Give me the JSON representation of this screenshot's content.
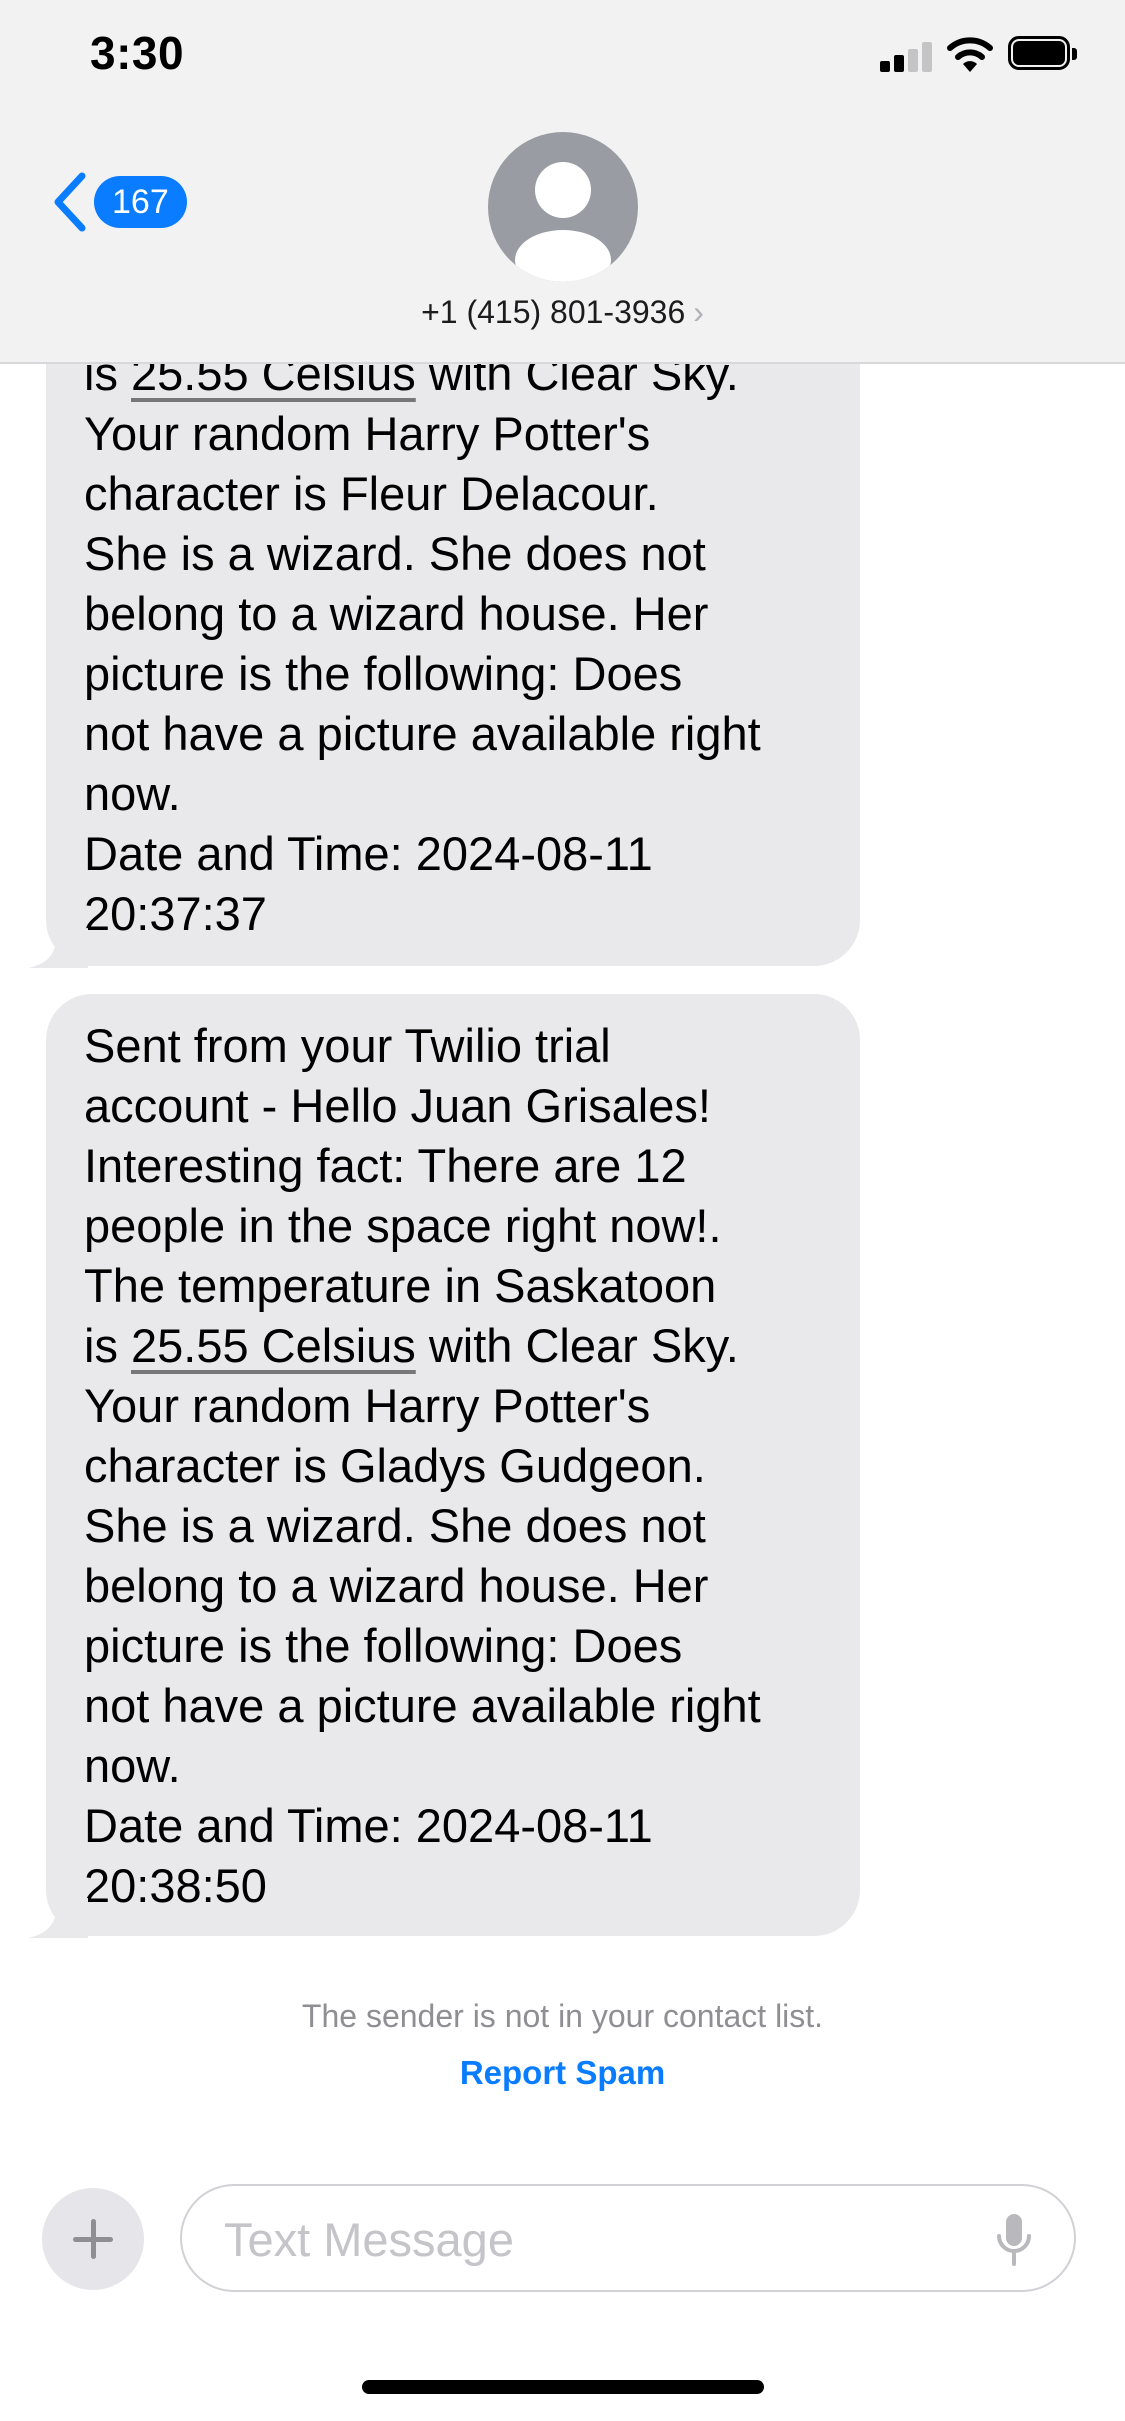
{
  "status_bar": {
    "time": "3:30",
    "icons": [
      "signal-icon",
      "wifi-icon",
      "battery-icon"
    ]
  },
  "header": {
    "back_icon": "chevron-left-icon",
    "unread_count": "167",
    "avatar_icon": "person-icon",
    "contact_number": "+1 (415) 801-3936",
    "contact_chevron": "›"
  },
  "messages": [
    {
      "segments": [
        {
          "text": "is "
        },
        {
          "text": "25.55 Celsius",
          "underline": true
        },
        {
          "text": " with Clear Sky.\nYour random Harry Potter's\ncharacter is Fleur Delacour.\n    She is a wizard. She does not\nbelong to a wizard house. Her\npicture is the following: Does\nnot have a picture available right\nnow.\n    Date and Time: 2024-08-11\n20:37:37"
        }
      ]
    },
    {
      "segments": [
        {
          "text": "Sent from your Twilio trial\naccount - Hello Juan Grisales!\nInteresting fact: There are 12\npeople in the space right now!.\n    The temperature in Saskatoon\nis "
        },
        {
          "text": "25.55 Celsius",
          "underline": true
        },
        {
          "text": " with Clear Sky.\nYour random Harry Potter's\ncharacter is Gladys Gudgeon.\n    She is a wizard. She does not\nbelong to a wizard house. Her\npicture is the following: Does\nnot have a picture available right\nnow.\n    Date and Time: 2024-08-11\n20:38:50"
        }
      ]
    }
  ],
  "notice": "The sender is not in your contact list.",
  "report_spam": "Report Spam",
  "compose": {
    "plus_icon": "plus-icon",
    "placeholder": "Text Message",
    "mic_icon": "microphone-icon"
  },
  "colors": {
    "accent": "#0a7cff",
    "bubble": "#e9e9eb",
    "header_bg": "#f2f2f3"
  }
}
